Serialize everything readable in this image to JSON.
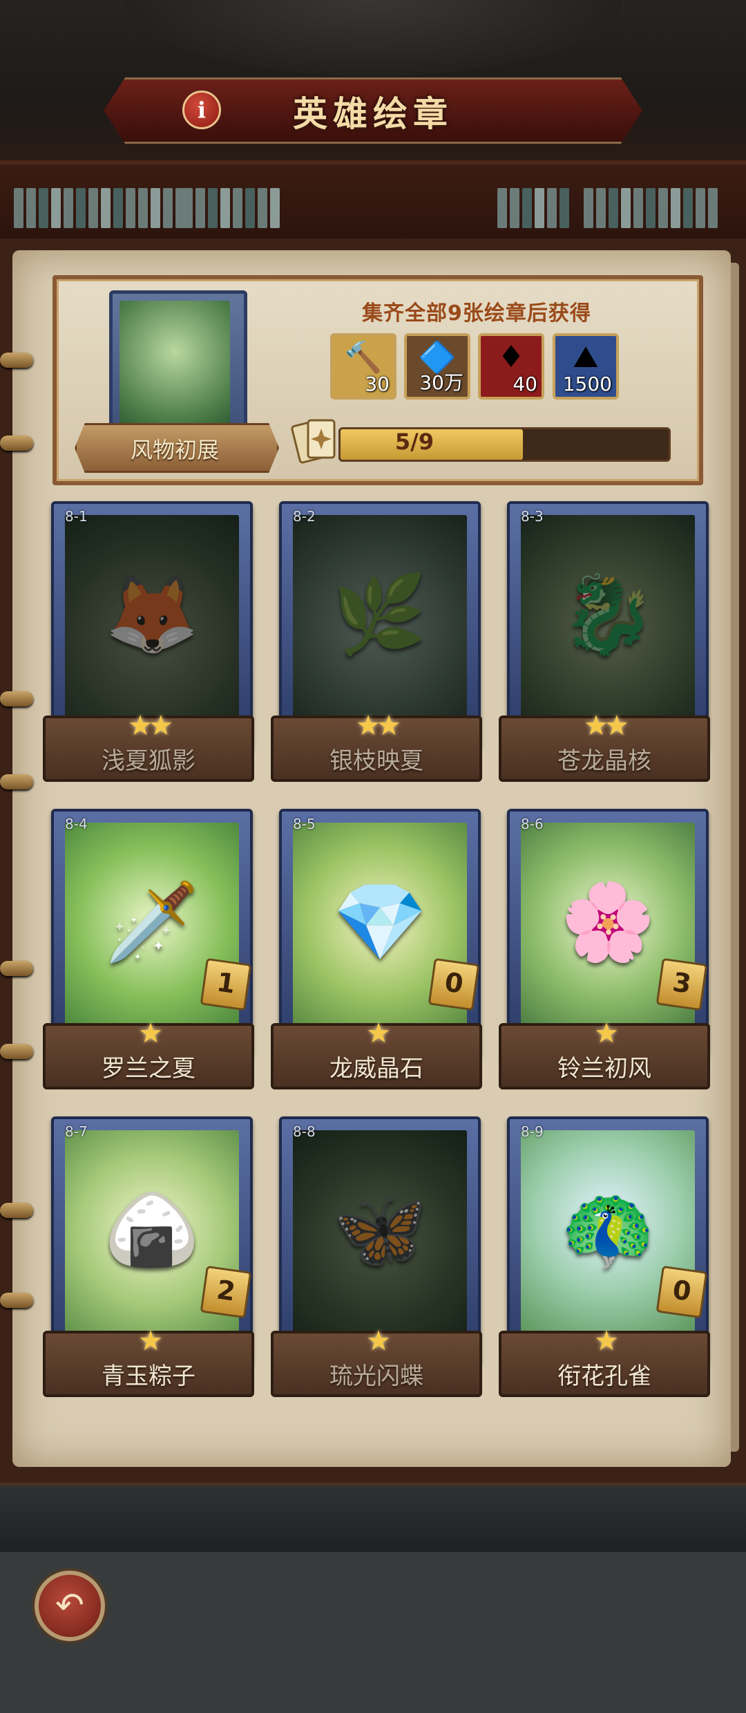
{
  "header": {
    "title": "英雄绘章",
    "info_icon": "i"
  },
  "album": {
    "name": "风物初展",
    "collect_text": "集齐全部9张绘章后获得",
    "progress_label": "5/9",
    "progress_value": 0.556,
    "rewards": [
      {
        "icon": "hammer-icon",
        "amount": "30",
        "bg": "#c9a24a"
      },
      {
        "icon": "blue-crystal-icon",
        "amount": "30万",
        "bg": "#6b4a2c"
      },
      {
        "icon": "red-gem-icon",
        "amount": "40",
        "bg": "#8c1c1c"
      },
      {
        "icon": "ore-pile-icon",
        "amount": "1500",
        "bg": "#2f4d8c"
      }
    ]
  },
  "cards": [
    {
      "id": "8-1",
      "name": "浅夏狐影",
      "stars": "★★",
      "count": "",
      "locked": true,
      "glyph": "🦊"
    },
    {
      "id": "8-2",
      "name": "银枝映夏",
      "stars": "★★",
      "count": "",
      "locked": true,
      "glyph": "🌿"
    },
    {
      "id": "8-3",
      "name": "苍龙晶核",
      "stars": "★★",
      "count": "",
      "locked": true,
      "glyph": "🐉"
    },
    {
      "id": "8-4",
      "name": "罗兰之夏",
      "stars": "★",
      "count": "1",
      "locked": false,
      "glyph": "🗡️"
    },
    {
      "id": "8-5",
      "name": "龙威晶石",
      "stars": "★",
      "count": "0",
      "locked": false,
      "glyph": "💎"
    },
    {
      "id": "8-6",
      "name": "铃兰初风",
      "stars": "★",
      "count": "3",
      "locked": false,
      "glyph": "🌸"
    },
    {
      "id": "8-7",
      "name": "青玉粽子",
      "stars": "★",
      "count": "2",
      "locked": false,
      "glyph": "🍙"
    },
    {
      "id": "8-8",
      "name": "琉光闪蝶",
      "stars": "★",
      "count": "",
      "locked": true,
      "glyph": "🦋"
    },
    {
      "id": "8-9",
      "name": "衔花孔雀",
      "stars": "★",
      "count": "0",
      "locked": false,
      "glyph": "🦚"
    }
  ],
  "footer": {
    "back_icon": "back-arrow-icon"
  }
}
